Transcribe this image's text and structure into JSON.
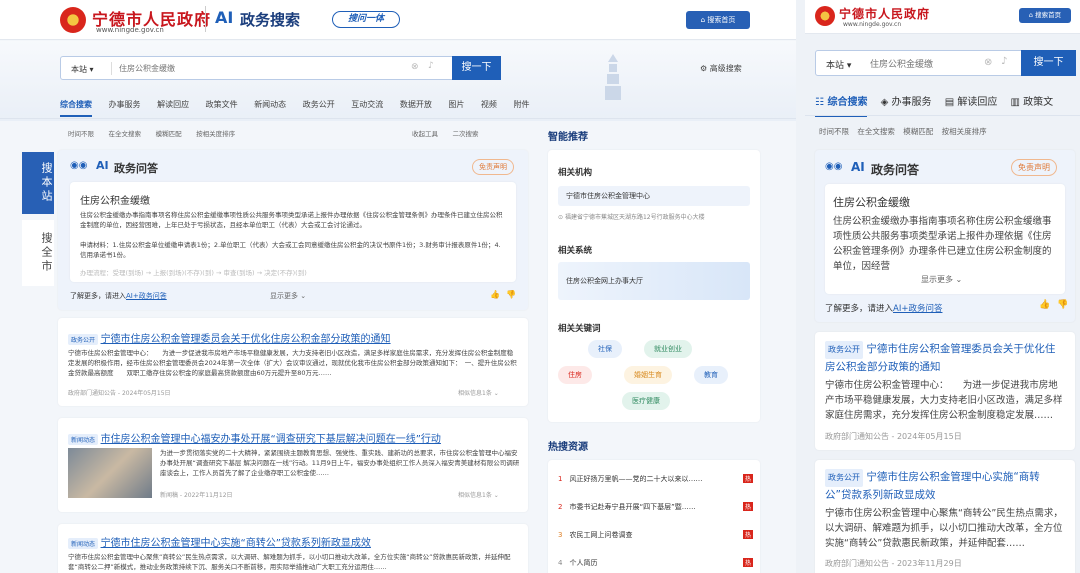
{
  "left": {
    "site_name": "宁德市人民政府",
    "site_url": "www.ningde.gov.cn",
    "search_brand": "政务搜索",
    "slogan": "搜问一体",
    "home_button": "搜索首页",
    "search": {
      "scope": "本站",
      "placeholder": "住房公积金缓缴",
      "button": "搜一下",
      "advanced": "高级搜索"
    },
    "tabs": [
      "综合搜索",
      "办事服务",
      "解读回应",
      "政策文件",
      "新闻动态",
      "政务公开",
      "互动交流",
      "数据开放",
      "图片",
      "视频",
      "附件"
    ],
    "filters": [
      "时间不限",
      "在全文搜索",
      "模糊匹配",
      "按相关度排序"
    ],
    "filters_right": [
      "收起工具",
      "二次搜索"
    ],
    "side_tabs": [
      "搜本站",
      "搜全市"
    ],
    "ai": {
      "title": "政务问答",
      "disclaimer": "免责声明",
      "q": "住房公积金缓缴",
      "p1": "住房公积金缓缴办事指南事项名称住房公积金缓缴事项性质公共服务事项类型承诺上报件办理依据《住房公积金管理条例》办理条件已建立住房公积金制度的单位，因经营困难，上年已处于亏损状态，且经本单位职工（代表）大会或工会讨论通过。",
      "p2": "申请材料：1.住房公积金单位缓缴申请表1份；2.单位职工（代表）大会或工会同意缓缴住房公积金的决议书原件1份；3.财务审计报表原件1份；4.信用承诺书1份。",
      "p3": "办理流程：受理(到场) → 上报(到场)(不存)(到) → 审查(到场) → 决定(不存)(到)",
      "more_pre": "了解更多，请进入",
      "more_link": "AI+政务问答",
      "expand": "显示更多"
    },
    "results": [
      {
        "badge": "政务公开",
        "title": "宁德市住房公积金管理委员会关于优化住房公积金部分政策的通知",
        "text": "宁德市住房公积金管理中心：　　为进一步促进我市房地产市场平稳健康发展，大力支持老旧小区改造，满足多样家庭住房需求，充分发挥住房公积金制度稳定发展的积极作用，经市住房公积金管理委员会2024年第一次全体（扩大）会议审议通过，现就优化我市住房公积金部分政策通知如下：　一、提升住房公积金贷款最高额度　　双职工缴存住房公积金的家庭最高贷款额度由60万元提升至80万元……",
        "meta": "政府部门通知公告 - 2024年05月15日",
        "related": "相似信息1条"
      },
      {
        "badge": "新闻动态",
        "title": "市住房公积金管理中心福安办事处开展“调查研究下基层解决问题在一线”行动",
        "text": "为进一步贯彻落实党的二十大精神，紧紧围绕主题教育思想、强党性、重实践、建新功的总要求，市住房公积金管理中心福安办事处开展“调查研究下基层 解决问题在一线”行动。11月9日上午，福安办事处组织工作人员深入福安青美建材有限公司调研座谈会上，工作人员首先了解了企业缴存职工公积金使……",
        "meta": "新闻稿 - 2022年11月12日",
        "related": "相似信息1条"
      },
      {
        "badge": "新闻动态",
        "title": "宁德市住房公积金管理中心实施“商转公”贷款系列新政显成效",
        "text": "宁德市住房公积金管理中心聚焦“商转公”民生热点需求，以大调研、解难题为抓手，以小切口推动大改革，全方位实施“商转公”贷款惠民新政策，并延伸配套“商转公二押”新模式，推动业务政策持续下沉、服务关口不断前移，用实际举措推动广大职工充分运用住……",
        "meta": "",
        "related": ""
      }
    ],
    "smart": {
      "title": "智能推荐",
      "org_h": "相关机构",
      "org": "宁德市住房公积金管理中心",
      "org_addr": "福建省宁德市蕉城区天湖东路12号行政服务中心大楼",
      "sys_h": "相关系统",
      "sys": "住房公积金网上办事大厅",
      "kw_h": "相关关键词",
      "kws": [
        "社保",
        "就业创业",
        "住房",
        "婚姻生育",
        "教育",
        "医疗健康"
      ]
    },
    "hot": {
      "title": "热搜资源",
      "items": [
        "风正好扬万里帆——党的二十大以来以……",
        "市委书记赴寿宁县开展“四下基层”暨……",
        "农民工网上问卷调查",
        "个人简历"
      ]
    }
  },
  "right": {
    "site_name": "宁德市人民政府",
    "site_url": "www.ningde.gov.cn",
    "home_button": "搜索首页",
    "search": {
      "scope": "本站",
      "placeholder": "住房公积金缓缴",
      "button": "搜一下"
    },
    "tabs": [
      "综合搜索",
      "办事服务",
      "解读回应",
      "政策文"
    ],
    "filters": [
      "时间不限",
      "在全文搜索",
      "模糊匹配",
      "按相关度排序"
    ],
    "ai": {
      "title": "政务问答",
      "disclaimer": "免责声明",
      "q": "住房公积金缓缴",
      "p": "住房公积金缓缴办事指南事项名称住房公积金缓缴事项性质公共服务事项类型承诺上报件办理依据《住房公积金管理条例》办理条件已建立住房公积金制度的单位，因经营",
      "expand": "显示更多",
      "more_pre": "了解更多，请进入",
      "more_link": "AI+政务问答"
    },
    "results": [
      {
        "badge": "政务公开",
        "title": "宁德市住房公积金管理委员会关于优化住房公积金部分政策的通知",
        "text": "宁德市住房公积金管理中心：　　为进一步促进我市房地产市场平稳健康发展，大力支持老旧小区改造，满足多样家庭住房需求，充分发挥住房公积金制度稳定发展……",
        "meta": "政府部门通知公告 - 2024年05月15日"
      },
      {
        "badge": "政务公开",
        "title": "宁德市住房公积金管理中心实施“商转公”贷款系列新政显成效",
        "text": "宁德市住房公积金管理中心聚焦“商转公”民生热点需求，以大调研、解难题为抓手，以小切口推动大改革，全方位实施“商转公”贷款惠民新政策，并延伸配套……",
        "meta": "政府部门通知公告 - 2023年11月29日"
      }
    ]
  }
}
